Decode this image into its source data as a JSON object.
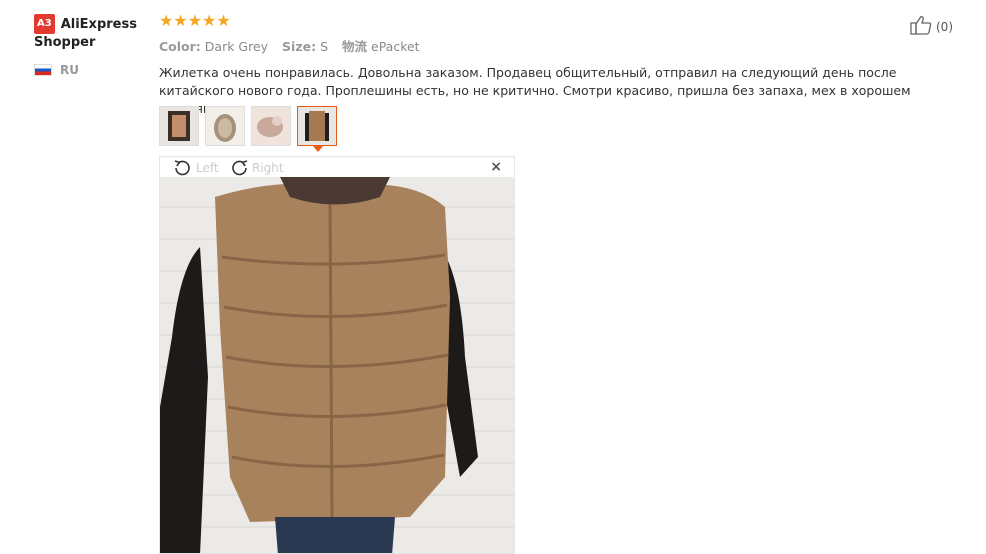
{
  "user": {
    "badge": "A3",
    "name": "AliExpress Shopper",
    "country": "RU"
  },
  "review": {
    "stars": "★★★★★",
    "rating": 5,
    "color_label": "Color:",
    "color_value": "Dark Grey",
    "size_label": "Size:",
    "size_value": "S",
    "shipping_label": "物流",
    "shipping_value": "ePacket",
    "text": "Жилетка очень понравилась. Довольна заказом. Продавец общительный, отправил на следующий день после китайского нового года. Проплешины есть, но не критично. Смотри красиво, пришла без запаха, мех в хорошем состоянии."
  },
  "helpful": {
    "count": "(0)"
  },
  "viewer": {
    "rotate_left": "Left",
    "rotate_right": "Right",
    "close": "×"
  },
  "colors": {
    "accent": "#e8591a",
    "star": "#f5a623",
    "badge": "#e23a2e"
  }
}
